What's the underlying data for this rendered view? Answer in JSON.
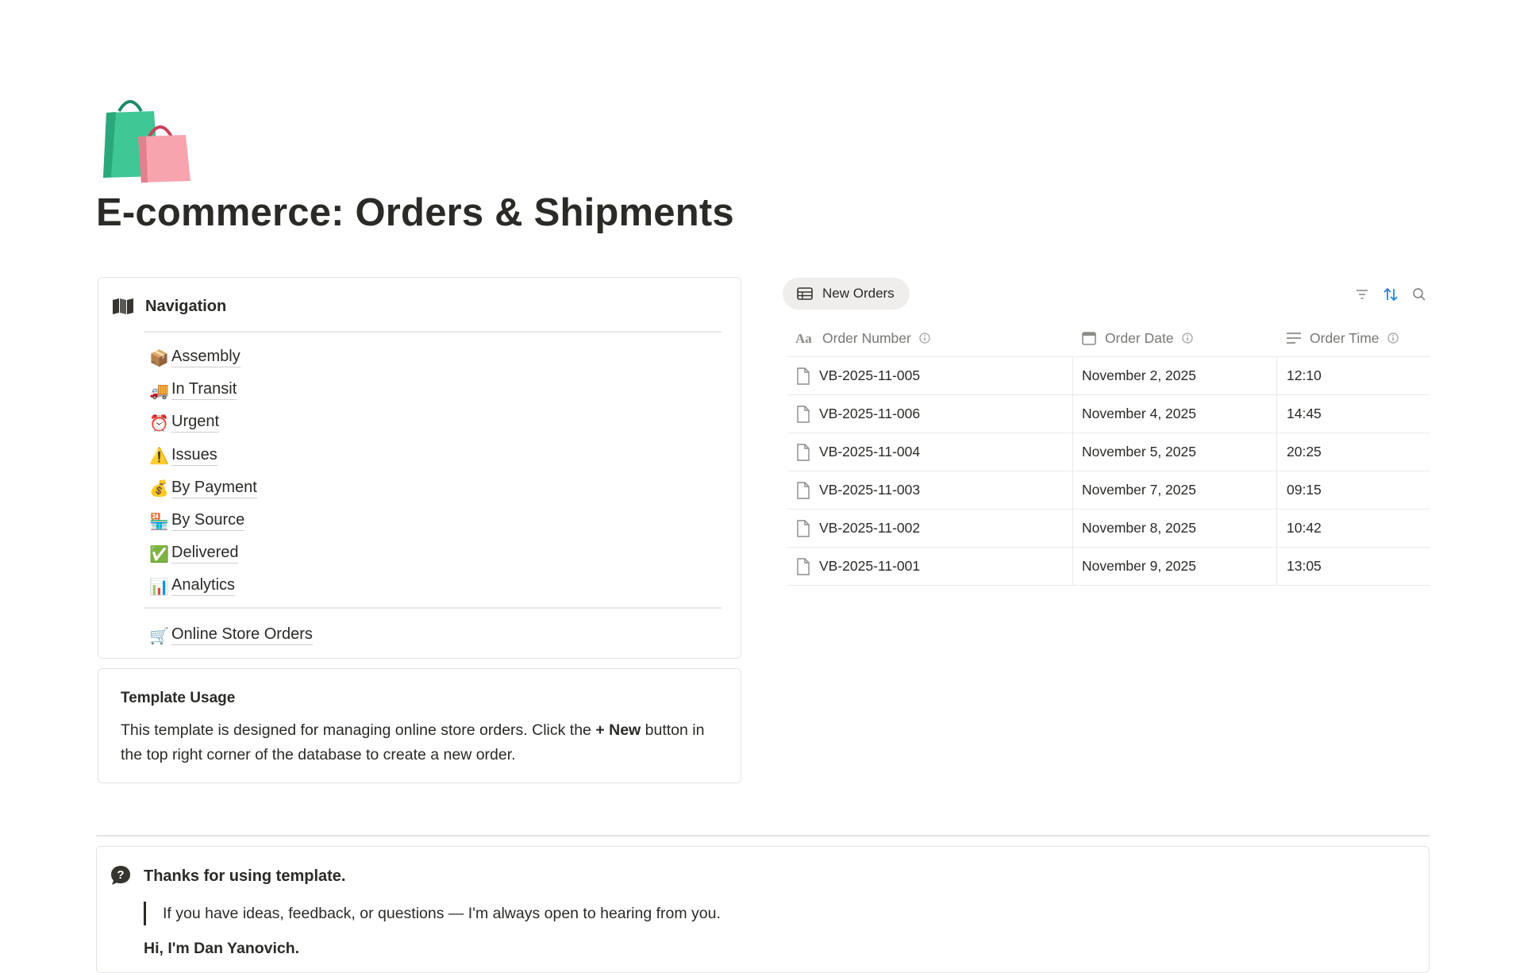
{
  "page": {
    "icon": "shopping-bags-icon",
    "title": "E-commerce: Orders & Shipments"
  },
  "navigation": {
    "icon": "map-icon",
    "title": "Navigation",
    "items": [
      {
        "emoji": "📦",
        "label": "Assembly"
      },
      {
        "emoji": "🚚",
        "label": "In Transit"
      },
      {
        "emoji": "⏰",
        "label": "Urgent"
      },
      {
        "emoji": "⚠️",
        "label": "Issues"
      },
      {
        "emoji": "💰",
        "label": "By Payment"
      },
      {
        "emoji": "🏪",
        "label": "By Source"
      },
      {
        "emoji": "✅",
        "label": "Delivered"
      },
      {
        "emoji": "📊",
        "label": "Analytics"
      }
    ],
    "extra": {
      "emoji": "🛒",
      "label": "Online Store Orders"
    }
  },
  "usage": {
    "title": "Template Usage",
    "text_before": "This template is designed for managing online store orders. Click the ",
    "text_bold": "+ New",
    "text_after": " button in the top right corner of the database to create a new order."
  },
  "database": {
    "view_label": "New Orders",
    "view_icon": "table-icon",
    "tools": [
      "filter-icon",
      "sort-icon",
      "search-icon"
    ],
    "accent": "#2383e2",
    "columns": [
      "Order Number",
      "Order Date",
      "Order Time"
    ],
    "rows": [
      {
        "number": "VB-2025-11-005",
        "date": "November 2, 2025",
        "time": "12:10"
      },
      {
        "number": "VB-2025-11-006",
        "date": "November 4, 2025",
        "time": "14:45"
      },
      {
        "number": "VB-2025-11-004",
        "date": "November 5, 2025",
        "time": "20:25"
      },
      {
        "number": "VB-2025-11-003",
        "date": "November 7, 2025",
        "time": "09:15"
      },
      {
        "number": "VB-2025-11-002",
        "date": "November 8, 2025",
        "time": "10:42"
      },
      {
        "number": "VB-2025-11-001",
        "date": "November 9, 2025",
        "time": "13:05"
      }
    ]
  },
  "thanks": {
    "icon": "help-bubble-icon",
    "title": "Thanks for using template.",
    "quote": "If you have ideas, feedback, or questions — I'm always open to hearing from you.",
    "greeting": "Hi, I'm Dan Yanovich."
  }
}
